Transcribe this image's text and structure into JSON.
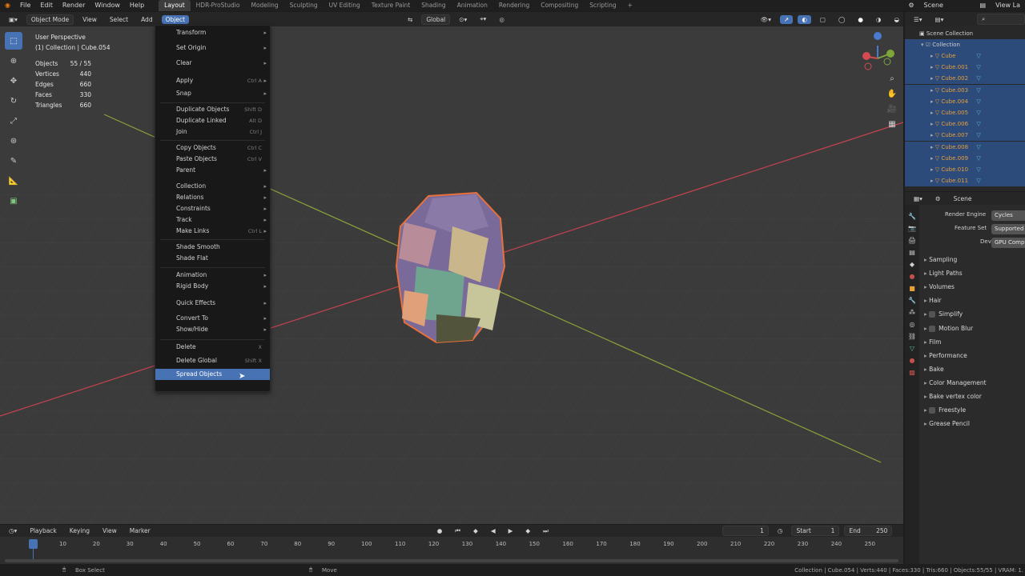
{
  "topbar": {
    "menus": [
      "File",
      "Edit",
      "Render",
      "Window",
      "Help"
    ],
    "workspaces": [
      "Layout",
      "HDR-ProStudio",
      "Modeling",
      "Sculpting",
      "UV Editing",
      "Texture Paint",
      "Shading",
      "Animation",
      "Rendering",
      "Compositing",
      "Scripting"
    ],
    "active_workspace": "Layout",
    "add_tab": "+",
    "scene_label": "Scene",
    "view_layer_label": "View La"
  },
  "viewport_header": {
    "mode": "Object Mode",
    "menus": [
      "View",
      "Select",
      "Add",
      "Object"
    ],
    "active_menu": "Object",
    "transform_orientation": "Global"
  },
  "overlay": {
    "title": "User Perspective",
    "subtitle": "(1) Collection | Cube.054",
    "stats": [
      {
        "label": "Objects",
        "value": "55 / 55"
      },
      {
        "label": "Vertices",
        "value": "440"
      },
      {
        "label": "Edges",
        "value": "660"
      },
      {
        "label": "Faces",
        "value": "330"
      },
      {
        "label": "Triangles",
        "value": "660"
      }
    ]
  },
  "object_menu": {
    "items": [
      {
        "label": "Transform",
        "shortcut": "",
        "submenu": true
      },
      {
        "label": "Set Origin",
        "shortcut": "",
        "submenu": true
      },
      {
        "label": "Clear",
        "shortcut": "",
        "submenu": true
      },
      {
        "label": "Apply",
        "shortcut": "Ctrl A",
        "submenu": true
      },
      {
        "label": "Snap",
        "shortcut": "",
        "submenu": true
      },
      {
        "label": "Duplicate Objects",
        "shortcut": "Shift D",
        "submenu": false
      },
      {
        "label": "Duplicate Linked",
        "shortcut": "Alt D",
        "submenu": false
      },
      {
        "label": "Join",
        "shortcut": "Ctrl J",
        "submenu": false
      },
      {
        "label": "Copy Objects",
        "shortcut": "Ctrl C",
        "submenu": false
      },
      {
        "label": "Paste Objects",
        "shortcut": "Ctrl V",
        "submenu": false
      },
      {
        "label": "Parent",
        "shortcut": "",
        "submenu": true
      },
      {
        "label": "Collection",
        "shortcut": "",
        "submenu": true
      },
      {
        "label": "Relations",
        "shortcut": "",
        "submenu": true
      },
      {
        "label": "Constraints",
        "shortcut": "",
        "submenu": true
      },
      {
        "label": "Track",
        "shortcut": "",
        "submenu": true
      },
      {
        "label": "Make Links",
        "shortcut": "Ctrl L",
        "submenu": true
      },
      {
        "label": "Shade Smooth",
        "shortcut": "",
        "submenu": false
      },
      {
        "label": "Shade Flat",
        "shortcut": "",
        "submenu": false
      },
      {
        "label": "Animation",
        "shortcut": "",
        "submenu": true
      },
      {
        "label": "Rigid Body",
        "shortcut": "",
        "submenu": true
      },
      {
        "label": "Quick Effects",
        "shortcut": "",
        "submenu": true
      },
      {
        "label": "Convert To",
        "shortcut": "",
        "submenu": true
      },
      {
        "label": "Show/Hide",
        "shortcut": "",
        "submenu": true
      },
      {
        "label": "Delete",
        "shortcut": "X",
        "submenu": false
      },
      {
        "label": "Delete Global",
        "shortcut": "Shift X",
        "submenu": false
      },
      {
        "label": "Spread Objects",
        "shortcut": "",
        "submenu": false
      }
    ],
    "highlighted": "Spread Objects"
  },
  "outliner": {
    "root": "Scene Collection",
    "collection": "Collection",
    "objects": [
      "Cube",
      "Cube.001",
      "Cube.002",
      "Cube.003",
      "Cube.004",
      "Cube.005",
      "Cube.006",
      "Cube.007",
      "Cube.008",
      "Cube.009",
      "Cube.010",
      "Cube.011"
    ]
  },
  "properties": {
    "header": "Scene",
    "fields": [
      {
        "label": "Render Engine",
        "value": "Cycles"
      },
      {
        "label": "Feature Set",
        "value": "Supported"
      },
      {
        "label": "Device",
        "value": "GPU Compu"
      }
    ],
    "sections": [
      {
        "label": "Sampling",
        "checkbox": false
      },
      {
        "label": "Light Paths",
        "checkbox": false
      },
      {
        "label": "Volumes",
        "checkbox": false
      },
      {
        "label": "Hair",
        "checkbox": false
      },
      {
        "label": "Simplify",
        "checkbox": true
      },
      {
        "label": "Motion Blur",
        "checkbox": true
      },
      {
        "label": "Film",
        "checkbox": false
      },
      {
        "label": "Performance",
        "checkbox": false
      },
      {
        "label": "Bake",
        "checkbox": false
      },
      {
        "label": "Color Management",
        "checkbox": false
      },
      {
        "label": "Bake vertex color",
        "checkbox": false
      },
      {
        "label": "Freestyle",
        "checkbox": true
      },
      {
        "label": "Grease Pencil",
        "checkbox": false
      }
    ]
  },
  "timeline": {
    "menus": [
      "Playback",
      "Keying",
      "View",
      "Marker"
    ],
    "current_frame": "1",
    "start_label": "Start",
    "start": "1",
    "end_label": "End",
    "end": "250",
    "ticks": [
      "1",
      "10",
      "20",
      "30",
      "40",
      "50",
      "60",
      "70",
      "80",
      "90",
      "100",
      "110",
      "120",
      "130",
      "140",
      "150",
      "160",
      "170",
      "180",
      "190",
      "200",
      "210",
      "220",
      "230",
      "240",
      "250"
    ]
  },
  "statusbar": {
    "left_hint": "Box Select",
    "mid_hint": "Move",
    "right_info": "Collection | Cube.054 | Verts:440 | Faces:330 | Tris:660 | Objects:55/55 | VRAM: 1."
  },
  "colors": {
    "accent": "#4772b3",
    "selection_outline": "#e8703a",
    "x_axis": "#c5434f",
    "y_axis": "#8aa33a"
  }
}
